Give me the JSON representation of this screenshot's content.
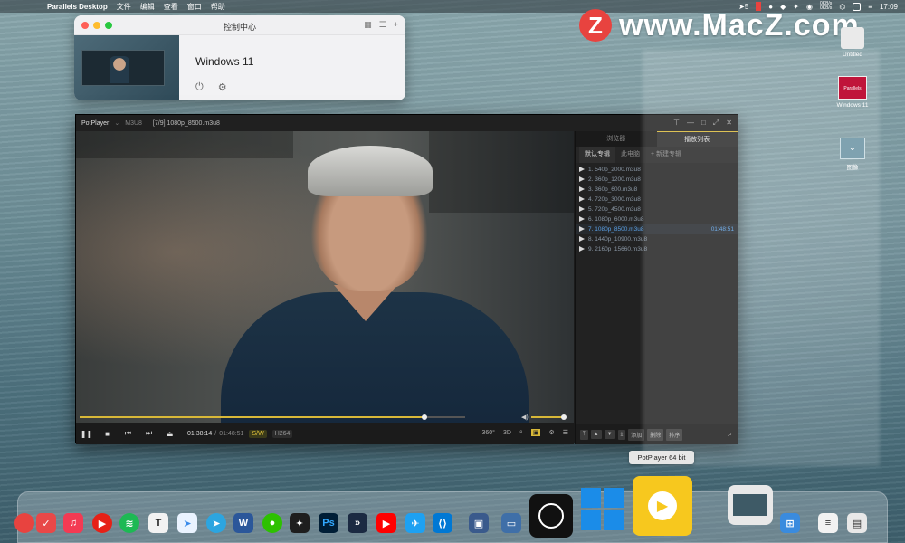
{
  "menubar": {
    "app": "Parallels Desktop",
    "items": [
      "文件",
      "编辑",
      "查看",
      "窗口",
      "帮助"
    ],
    "status_badge": "5",
    "net_up": "0KB/s",
    "net_down": "0KB/s",
    "clock": "17:09"
  },
  "watermark": {
    "logo": "Z",
    "text": "www.MacZ.com"
  },
  "control_center": {
    "title": "控制中心",
    "vm_name": "Windows 11"
  },
  "potplayer": {
    "brand": "PotPlayer",
    "format": "M3U8",
    "file_title": "[7/9] 1080p_8500.m3u8",
    "panel_tabs": [
      "浏览器",
      "播放列表"
    ],
    "panel_active_tab": 1,
    "subtabs": [
      "默认专辑",
      "此电脑",
      "+ 新建专辑"
    ],
    "playlist": [
      {
        "label": "1. 540p_2000.m3u8",
        "time": ""
      },
      {
        "label": "2. 360p_1200.m3u8",
        "time": ""
      },
      {
        "label": "3. 360p_600.m3u8",
        "time": ""
      },
      {
        "label": "4. 720p_3000.m3u8",
        "time": ""
      },
      {
        "label": "5. 720p_4500.m3u8",
        "time": ""
      },
      {
        "label": "6. 1080p_6000.m3u8",
        "time": ""
      },
      {
        "label": "7. 1080p_8500.m3u8",
        "time": "01:48:51",
        "active": true
      },
      {
        "label": "8. 1440p_10900.m3u8",
        "time": ""
      },
      {
        "label": "9. 2160p_15660.m3u8",
        "time": ""
      }
    ],
    "playlist_buttons": [
      "添加",
      "删除",
      "排序"
    ],
    "current_time": "01:38:14",
    "duration": "01:48:51",
    "duration_sep": "/",
    "decoder_tag": "S/W",
    "codec_tag": "H264",
    "seek_progress": 0.902,
    "volume_level": 0.9,
    "right_controls": [
      "360°",
      "3D"
    ]
  },
  "desktop_icons": [
    {
      "name": "untitled",
      "label": "Untitled"
    },
    {
      "name": "windows11",
      "label": "Windows 11",
      "logo_text": "Parallels"
    },
    {
      "name": "image",
      "label": "图像"
    }
  ],
  "tooltip": "PotPlayer 64 bit",
  "colors": {
    "accent_yellow": "#d8b838",
    "playlist_active": "#5aa0e6",
    "watermark_red": "#e8433f"
  }
}
